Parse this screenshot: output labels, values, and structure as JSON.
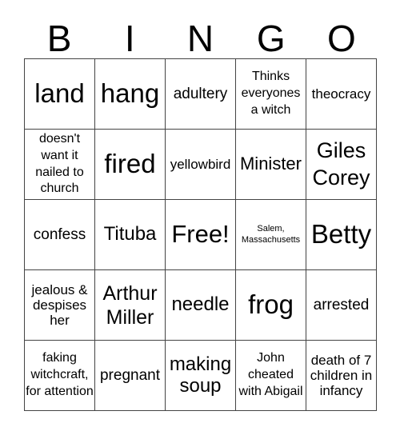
{
  "header": [
    "B",
    "I",
    "N",
    "G",
    "O"
  ],
  "rows": [
    [
      "land",
      "hang",
      "adultery",
      "Thinks everyones a witch",
      "theocracy"
    ],
    [
      "doesn't want it nailed to church",
      "fired",
      "yellowbird",
      "Minister",
      "Giles Corey"
    ],
    [
      "confess",
      "Tituba",
      "Free!",
      "Salem, Massachusetts",
      "Betty"
    ],
    [
      "jealous & despises her",
      "Arthur Miller",
      "needle",
      "frog",
      "arrested"
    ],
    [
      "faking witchcraft, for attention",
      "pregnant",
      "making soup",
      "John cheated with Abigail",
      "death of 7 children in infancy"
    ]
  ]
}
